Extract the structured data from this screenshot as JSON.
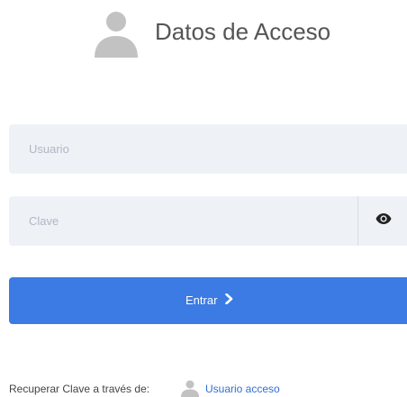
{
  "header": {
    "title": "Datos de Acceso",
    "icon": "user-avatar-icon"
  },
  "form": {
    "username_placeholder": "Usuario",
    "username_value": "",
    "password_placeholder": "Clave",
    "password_value": "",
    "toggle_icon": "eye-icon",
    "submit_label": "Entrar",
    "submit_icon": "chevron-right-icon"
  },
  "recover": {
    "text": "Recuperar Clave a través de:",
    "icon": "user-icon",
    "link_label": "Usuario acceso"
  },
  "colors": {
    "accent": "#3b7be3",
    "field_bg": "#eef2f7",
    "link": "#2f6fd6",
    "icon_gray": "#c2c2c2"
  }
}
